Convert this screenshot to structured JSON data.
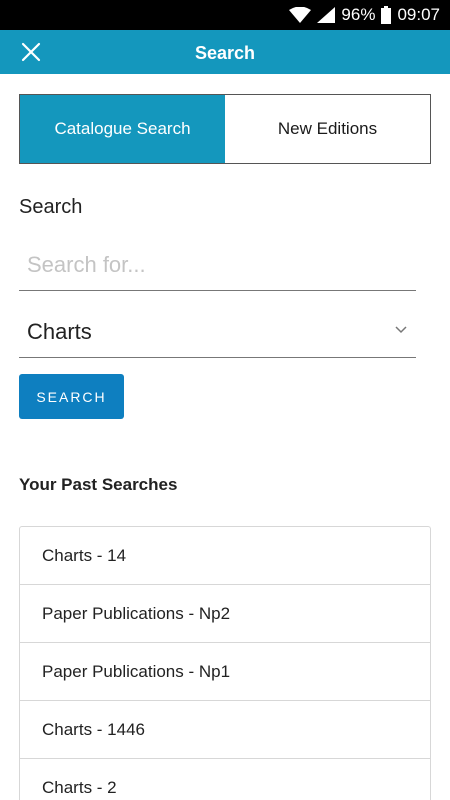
{
  "status_bar": {
    "battery": "96%",
    "time": "09:07",
    "icons": [
      "wifi-icon",
      "signal-icon",
      "battery-icon"
    ]
  },
  "app_bar": {
    "title": "Search",
    "close_icon": "close-icon",
    "color": "#1497bd"
  },
  "tabs": [
    {
      "label": "Catalogue Search",
      "active": true
    },
    {
      "label": "New Editions",
      "active": false
    }
  ],
  "search": {
    "label": "Search",
    "placeholder": "Search for...",
    "value": "",
    "category": "Charts",
    "button_label": "SEARCH"
  },
  "past_searches": {
    "title": "Your Past Searches",
    "items": [
      "Charts - 14",
      "Paper Publications - Np2",
      "Paper Publications - Np1",
      "Charts - 1446",
      "Charts - 2"
    ]
  },
  "colors": {
    "accent": "#1497bd",
    "button": "#0e7fc0"
  }
}
